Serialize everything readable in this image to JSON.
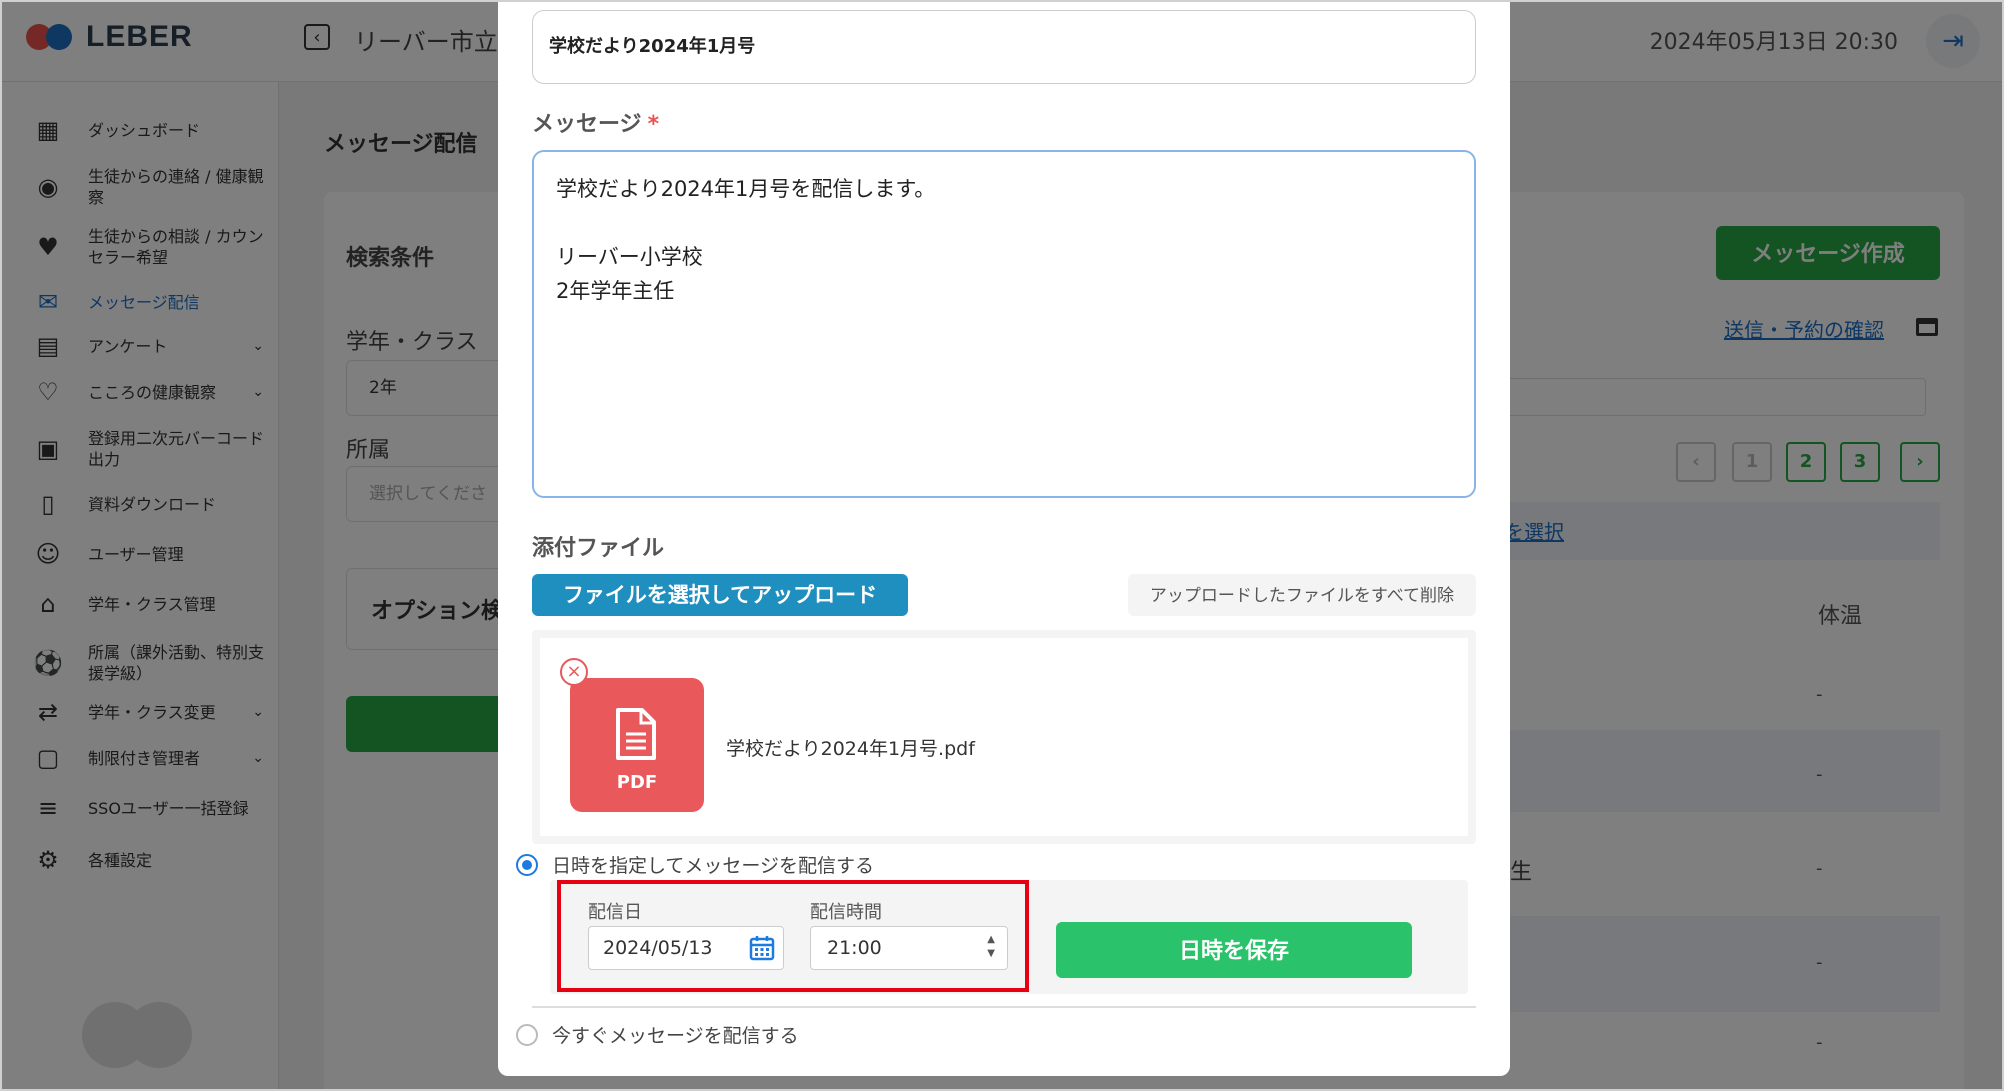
{
  "app": {
    "logo_text": "LEBER",
    "school_title": "リーバー市立小",
    "datetime": "2024年05月13日 20:30"
  },
  "sidebar": {
    "items": [
      {
        "label": "ダッシュボード",
        "icon": "dashboard-icon"
      },
      {
        "label": "生徒からの連絡 / 健康観察",
        "icon": "broadcast-icon"
      },
      {
        "label": "生徒からの相談 / カウンセラー希望",
        "icon": "heart-chat-icon"
      },
      {
        "label": "メッセージ配信",
        "icon": "mail-icon",
        "active": true
      },
      {
        "label": "アンケート",
        "icon": "survey-icon",
        "expandable": true
      },
      {
        "label": "こころの健康観察",
        "icon": "heart-hand-icon",
        "expandable": true
      },
      {
        "label": "登録用二次元バーコード出力",
        "icon": "qr-code-icon"
      },
      {
        "label": "資料ダウンロード",
        "icon": "document-icon"
      },
      {
        "label": "ユーザー管理",
        "icon": "users-icon"
      },
      {
        "label": "学年・クラス管理",
        "icon": "school-icon"
      },
      {
        "label": "所属（課外活動、特別支援学級）",
        "icon": "ball-icon"
      },
      {
        "label": "学年・クラス変更",
        "icon": "user-swap-icon",
        "expandable": true
      },
      {
        "label": "制限付き管理者",
        "icon": "restricted-user-icon",
        "expandable": true
      },
      {
        "label": "SSOユーザー一括登録",
        "icon": "database-icon"
      },
      {
        "label": "各種設定",
        "icon": "gear-icon"
      }
    ]
  },
  "background": {
    "page_title": "メッセージ配信",
    "search_title": "検索条件",
    "grade_class_label": "学年・クラス",
    "grade_value": "2年",
    "affiliation_label": "所属",
    "affiliation_placeholder": "選択してくださ",
    "option_label": "オプション検",
    "create_button": "メッセージ作成",
    "confirm_link": "送信・予約の確認",
    "pages": [
      "1",
      "2",
      "3"
    ],
    "select_link": "を選択",
    "col_temp": "体温",
    "row_dash": "-",
    "row_partial": "生"
  },
  "modal": {
    "subject_value": "学校だより2024年1月号",
    "message_label": "メッセージ",
    "required_mark": "*",
    "message_body": "学校だより2024年1月号を配信します。\n\nリーバー小学校\n2年学年主任",
    "attachment_label": "添付ファイル",
    "upload_button": "ファイルを選択してアップロード",
    "delete_all_button": "アップロードしたファイルをすべて削除",
    "file": {
      "type_label": "PDF",
      "name": "学校だより2024年1月号.pdf"
    },
    "schedule_option": "日時を指定してメッセージを配信する",
    "schedule_selected": true,
    "date_label": "配信日",
    "date_value": "2024/05/13",
    "time_label": "配信時間",
    "time_value": "21:00",
    "save_button": "日時を保存",
    "now_option": "今すぐメッセージを配信する",
    "colors": {
      "highlight": "#e60012",
      "save_green": "#2ac36b",
      "upload_blue": "#1f8fbf",
      "pdf_red": "#e9585a"
    }
  }
}
